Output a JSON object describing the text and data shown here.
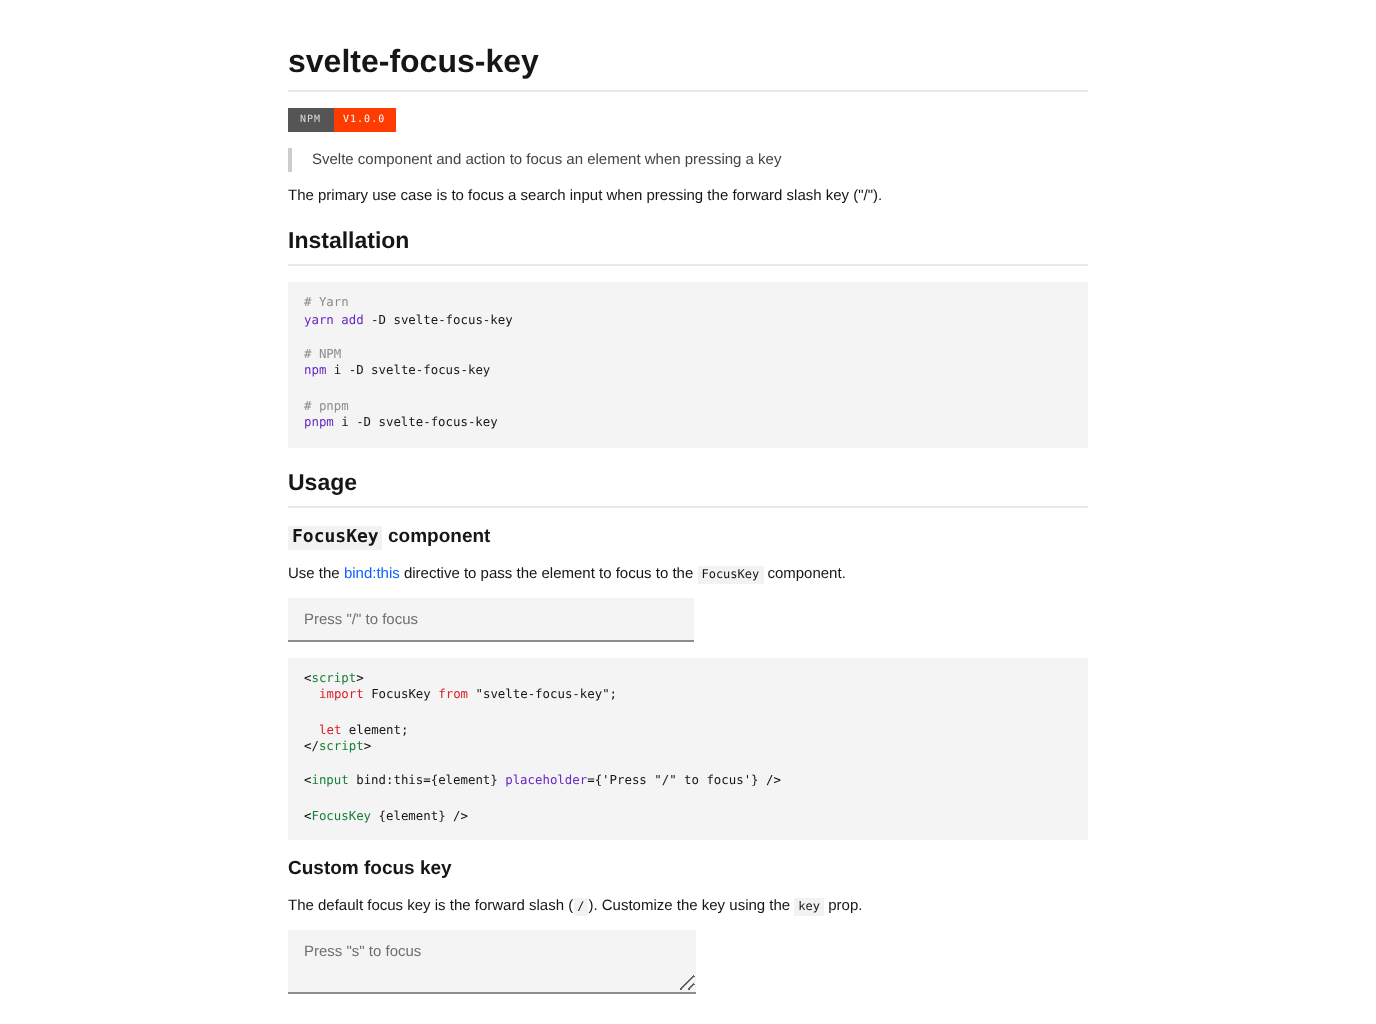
{
  "title": "svelte-focus-key",
  "badge": {
    "label": "NPM",
    "value": "V1.0.0"
  },
  "blockquote": "Svelte component and action to focus an element when pressing a key",
  "intro": "The primary use case is to focus a search input when pressing the forward slash key (\"/\").",
  "sections": [
    {
      "kind": "h2",
      "text": "Installation"
    },
    {
      "kind": "code",
      "lines": [
        {
          "tokens": [
            {
              "t": "# Yarn",
              "kind": "comment"
            }
          ]
        },
        {
          "tokens": [
            {
              "t": "yarn add",
              "kind": "keyword"
            },
            {
              "t": " -D svelte-focus-key",
              "kind": "plain"
            }
          ]
        },
        {
          "gap_before": true,
          "tokens": [
            {
              "t": "# NPM",
              "kind": "comment"
            }
          ]
        },
        {
          "tokens": [
            {
              "t": "npm",
              "kind": "keyword"
            },
            {
              "t": " i -D svelte-focus-key",
              "kind": "plain"
            }
          ]
        },
        {
          "gap_before": true,
          "tokens": [
            {
              "t": "# pnpm",
              "kind": "comment"
            }
          ]
        },
        {
          "tokens": [
            {
              "t": "pnpm",
              "kind": "keyword"
            },
            {
              "t": " i -D svelte-focus-key",
              "kind": "plain"
            }
          ]
        }
      ]
    },
    {
      "kind": "h2",
      "text": "Usage"
    },
    {
      "kind": "h3",
      "parts": [
        {
          "kind": "code",
          "t": "FocusKey"
        },
        {
          "kind": "text",
          "t": " component"
        }
      ]
    },
    {
      "kind": "p",
      "parts": [
        {
          "kind": "text",
          "t": "Use the "
        },
        {
          "kind": "link",
          "t": "bind:this"
        },
        {
          "kind": "text",
          "t": " directive to pass the element to focus to the "
        },
        {
          "kind": "code",
          "t": "FocusKey"
        },
        {
          "kind": "text",
          "t": " component."
        }
      ]
    },
    {
      "kind": "input",
      "placeholder": "Press \"/\" to focus"
    },
    {
      "kind": "code",
      "lines": [
        {
          "tokens": [
            {
              "t": "<",
              "kind": "plain"
            },
            {
              "t": "script",
              "kind": "tag"
            },
            {
              "t": ">",
              "kind": "plain"
            }
          ]
        },
        {
          "indent": true,
          "tokens": [
            {
              "t": "import",
              "kind": "keyword2"
            },
            {
              "t": " FocusKey ",
              "kind": "plain"
            },
            {
              "t": "from",
              "kind": "keyword2"
            },
            {
              "t": " \"svelte-focus-key\";",
              "kind": "plain"
            }
          ]
        },
        {
          "gap_before": true,
          "indent": true,
          "tokens": [
            {
              "t": "let",
              "kind": "keyword2"
            },
            {
              "t": " element;",
              "kind": "plain"
            }
          ]
        },
        {
          "tokens": [
            {
              "t": "</",
              "kind": "plain"
            },
            {
              "t": "script",
              "kind": "tag"
            },
            {
              "t": ">",
              "kind": "plain"
            }
          ]
        },
        {
          "gap_before": true,
          "tokens": [
            {
              "t": "<",
              "kind": "plain"
            },
            {
              "t": "input",
              "kind": "tag"
            },
            {
              "t": " bind:this={element} ",
              "kind": "plain"
            },
            {
              "t": "placeholder",
              "kind": "keyword"
            },
            {
              "t": "={'Press \"/\" to focus'} />",
              "kind": "plain"
            }
          ]
        },
        {
          "gap_before": true,
          "tokens": [
            {
              "t": "<",
              "kind": "plain"
            },
            {
              "t": "FocusKey",
              "kind": "tag"
            },
            {
              "t": " {element} />",
              "kind": "plain"
            }
          ]
        }
      ]
    },
    {
      "kind": "h3",
      "parts": [
        {
          "kind": "text",
          "t": "Custom focus key"
        }
      ]
    },
    {
      "kind": "p",
      "parts": [
        {
          "kind": "text",
          "t": "The default focus key is the forward slash ("
        },
        {
          "kind": "code",
          "t": "/"
        },
        {
          "kind": "text",
          "t": "). Customize the key using the "
        },
        {
          "kind": "code",
          "t": "key"
        },
        {
          "kind": "text",
          "t": " prop."
        }
      ]
    },
    {
      "kind": "textarea",
      "placeholder": "Press \"s\" to focus"
    }
  ]
}
